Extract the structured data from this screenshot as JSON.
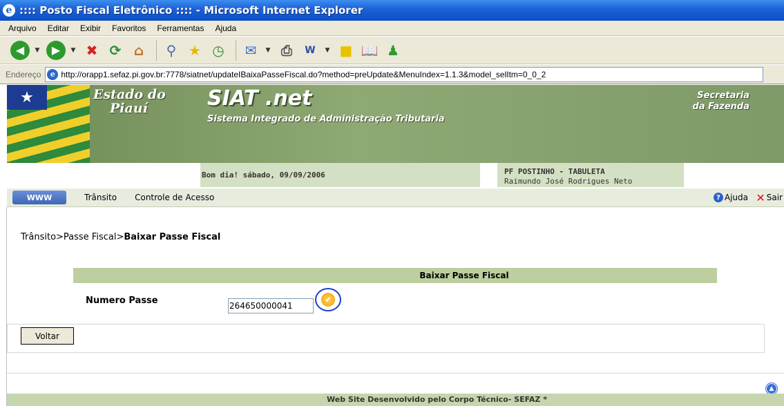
{
  "window": {
    "title": ":::: Posto Fiscal Eletrônico :::: - Microsoft Internet Explorer"
  },
  "menu": {
    "items": [
      "Arquivo",
      "Editar",
      "Exibir",
      "Favoritos",
      "Ferramentas",
      "Ajuda"
    ]
  },
  "toolbar": {
    "buttons": [
      "back-icon",
      "forward-icon",
      "stop-icon",
      "refresh-icon",
      "home-icon",
      "search-icon",
      "favorites-icon",
      "history-icon",
      "mail-icon",
      "print-icon",
      "word-icon",
      "notes-icon",
      "research-icon",
      "messenger-icon"
    ]
  },
  "address": {
    "label": "Endereço",
    "url": "http://orapp1.sefaz.pi.gov.br:7778/siatnet/updateIBaixaPasseFiscal.do?method=preUpdate&MenuIndex=1.1.3&model_selItm=0_0_2"
  },
  "banner": {
    "estado_line1": "Estado do",
    "estado_line2": "Piauí",
    "siat_title": "SIAT .net",
    "siat_subtitle": "Sistema Integrado de Administração Tributaria",
    "secretaria_line1": "Secretaria",
    "secretaria_line2": "da Fazenda",
    "greeting": "Bom dia! sábado, 09/09/2006",
    "post_name": "PF POSTINHO - TABULETA",
    "user_name": "Raimundo José Rodrigues Neto"
  },
  "nav": {
    "www_label": "WWW",
    "items": [
      "Trânsito",
      "Controle de Acesso"
    ],
    "help_label": "Ajuda",
    "exit_label": "Sair"
  },
  "page": {
    "breadcrumb_prefix": "Trânsito>Passe Fiscal>",
    "breadcrumb_current": "Baixar Passe Fiscal",
    "form_title": "Baixar Passe Fiscal",
    "field_label": "Numero Passe",
    "field_value": "264650000041",
    "back_button": "Voltar"
  },
  "footer": {
    "text": "Web Site Desenvolvido pelo Corpo Técnico- SEFAZ *"
  },
  "colors": {
    "header_green": "#bdcf9f",
    "banner_green": "#7f9c6a",
    "title_blue": "#0c4fc4"
  }
}
